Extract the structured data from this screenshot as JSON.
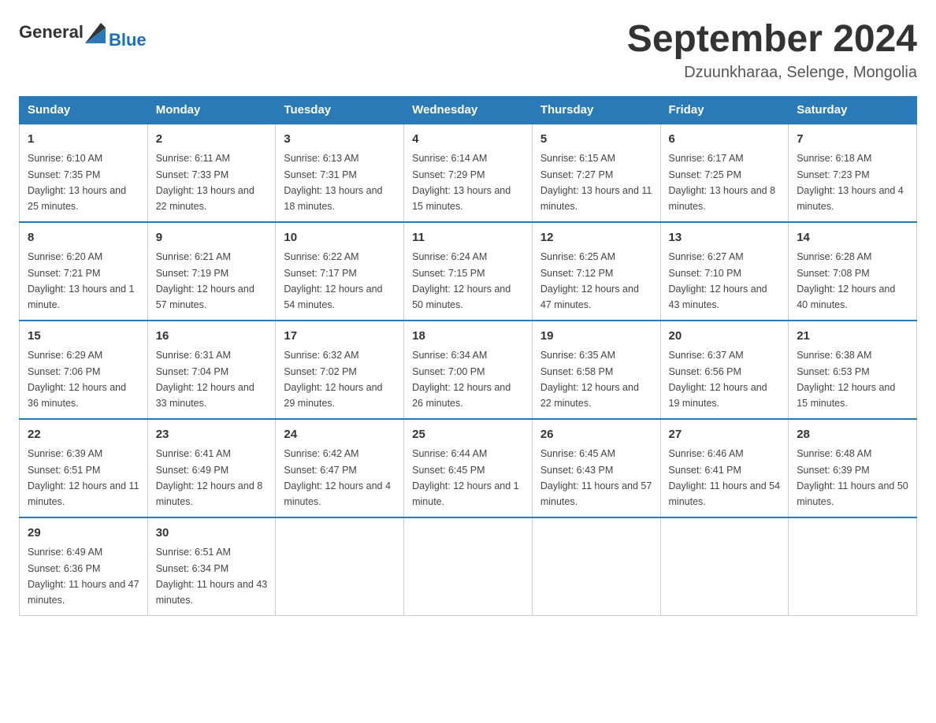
{
  "logo": {
    "text_general": "General",
    "text_blue": "Blue"
  },
  "title": "September 2024",
  "subtitle": "Dzuunkharaa, Selenge, Mongolia",
  "days_of_week": [
    "Sunday",
    "Monday",
    "Tuesday",
    "Wednesday",
    "Thursday",
    "Friday",
    "Saturday"
  ],
  "weeks": [
    [
      {
        "day": "1",
        "sunrise": "6:10 AM",
        "sunset": "7:35 PM",
        "daylight": "13 hours and 25 minutes."
      },
      {
        "day": "2",
        "sunrise": "6:11 AM",
        "sunset": "7:33 PM",
        "daylight": "13 hours and 22 minutes."
      },
      {
        "day": "3",
        "sunrise": "6:13 AM",
        "sunset": "7:31 PM",
        "daylight": "13 hours and 18 minutes."
      },
      {
        "day": "4",
        "sunrise": "6:14 AM",
        "sunset": "7:29 PM",
        "daylight": "13 hours and 15 minutes."
      },
      {
        "day": "5",
        "sunrise": "6:15 AM",
        "sunset": "7:27 PM",
        "daylight": "13 hours and 11 minutes."
      },
      {
        "day": "6",
        "sunrise": "6:17 AM",
        "sunset": "7:25 PM",
        "daylight": "13 hours and 8 minutes."
      },
      {
        "day": "7",
        "sunrise": "6:18 AM",
        "sunset": "7:23 PM",
        "daylight": "13 hours and 4 minutes."
      }
    ],
    [
      {
        "day": "8",
        "sunrise": "6:20 AM",
        "sunset": "7:21 PM",
        "daylight": "13 hours and 1 minute."
      },
      {
        "day": "9",
        "sunrise": "6:21 AM",
        "sunset": "7:19 PM",
        "daylight": "12 hours and 57 minutes."
      },
      {
        "day": "10",
        "sunrise": "6:22 AM",
        "sunset": "7:17 PM",
        "daylight": "12 hours and 54 minutes."
      },
      {
        "day": "11",
        "sunrise": "6:24 AM",
        "sunset": "7:15 PM",
        "daylight": "12 hours and 50 minutes."
      },
      {
        "day": "12",
        "sunrise": "6:25 AM",
        "sunset": "7:12 PM",
        "daylight": "12 hours and 47 minutes."
      },
      {
        "day": "13",
        "sunrise": "6:27 AM",
        "sunset": "7:10 PM",
        "daylight": "12 hours and 43 minutes."
      },
      {
        "day": "14",
        "sunrise": "6:28 AM",
        "sunset": "7:08 PM",
        "daylight": "12 hours and 40 minutes."
      }
    ],
    [
      {
        "day": "15",
        "sunrise": "6:29 AM",
        "sunset": "7:06 PM",
        "daylight": "12 hours and 36 minutes."
      },
      {
        "day": "16",
        "sunrise": "6:31 AM",
        "sunset": "7:04 PM",
        "daylight": "12 hours and 33 minutes."
      },
      {
        "day": "17",
        "sunrise": "6:32 AM",
        "sunset": "7:02 PM",
        "daylight": "12 hours and 29 minutes."
      },
      {
        "day": "18",
        "sunrise": "6:34 AM",
        "sunset": "7:00 PM",
        "daylight": "12 hours and 26 minutes."
      },
      {
        "day": "19",
        "sunrise": "6:35 AM",
        "sunset": "6:58 PM",
        "daylight": "12 hours and 22 minutes."
      },
      {
        "day": "20",
        "sunrise": "6:37 AM",
        "sunset": "6:56 PM",
        "daylight": "12 hours and 19 minutes."
      },
      {
        "day": "21",
        "sunrise": "6:38 AM",
        "sunset": "6:53 PM",
        "daylight": "12 hours and 15 minutes."
      }
    ],
    [
      {
        "day": "22",
        "sunrise": "6:39 AM",
        "sunset": "6:51 PM",
        "daylight": "12 hours and 11 minutes."
      },
      {
        "day": "23",
        "sunrise": "6:41 AM",
        "sunset": "6:49 PM",
        "daylight": "12 hours and 8 minutes."
      },
      {
        "day": "24",
        "sunrise": "6:42 AM",
        "sunset": "6:47 PM",
        "daylight": "12 hours and 4 minutes."
      },
      {
        "day": "25",
        "sunrise": "6:44 AM",
        "sunset": "6:45 PM",
        "daylight": "12 hours and 1 minute."
      },
      {
        "day": "26",
        "sunrise": "6:45 AM",
        "sunset": "6:43 PM",
        "daylight": "11 hours and 57 minutes."
      },
      {
        "day": "27",
        "sunrise": "6:46 AM",
        "sunset": "6:41 PM",
        "daylight": "11 hours and 54 minutes."
      },
      {
        "day": "28",
        "sunrise": "6:48 AM",
        "sunset": "6:39 PM",
        "daylight": "11 hours and 50 minutes."
      }
    ],
    [
      {
        "day": "29",
        "sunrise": "6:49 AM",
        "sunset": "6:36 PM",
        "daylight": "11 hours and 47 minutes."
      },
      {
        "day": "30",
        "sunrise": "6:51 AM",
        "sunset": "6:34 PM",
        "daylight": "11 hours and 43 minutes."
      },
      null,
      null,
      null,
      null,
      null
    ]
  ]
}
